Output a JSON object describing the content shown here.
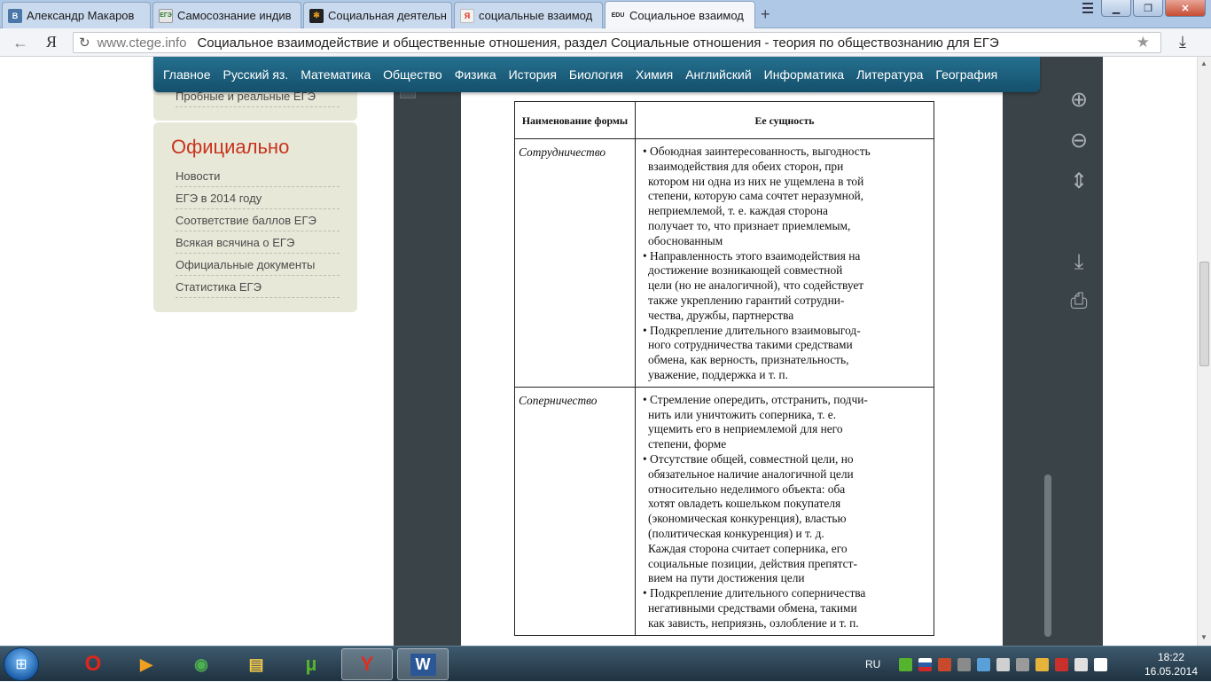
{
  "browser": {
    "tabs": [
      {
        "icon": "vk-favicon",
        "icon_text": "В",
        "title": "Александр Макаров"
      },
      {
        "icon": "ege-favicon",
        "icon_text": "ЕГЭ",
        "title": "Самосознание индив"
      },
      {
        "icon": "joomla-favicon",
        "icon_text": "✻",
        "title": "Социальная деятельн"
      },
      {
        "icon": "yandex-favicon",
        "icon_text": "Я",
        "title": "социальные взаимод"
      },
      {
        "icon": "edu-favicon",
        "icon_text": "EDU",
        "title": "Социальное взаимод"
      }
    ],
    "new_tab": "+",
    "yandex_logo": "Я",
    "address": {
      "domain": "www.ctege.info",
      "title": "Социальное взаимодействие и общественные отношения, раздел Социальные отношения - теория по обществознанию для ЕГЭ"
    },
    "window_buttons": {
      "minimize": "▁",
      "maximize": "❐",
      "close": "✕"
    }
  },
  "site": {
    "nav": [
      "Главное",
      "Русский яз.",
      "Математика",
      "Общество",
      "Физика",
      "История",
      "Биология",
      "Химия",
      "Английский",
      "Информатика",
      "Литература",
      "География"
    ],
    "sidebar_prev_link": "Пробные и реальные ЕГЭ",
    "official": {
      "title": "Официально",
      "links": [
        "Новости",
        "ЕГЭ в 2014 году",
        "Соответствие баллов ЕГЭ",
        "Всякая всячина о ЕГЭ",
        "Официальные документы",
        "Статистика ЕГЭ"
      ]
    }
  },
  "document": {
    "headers": {
      "form": "Наименование формы",
      "essence": "Ее сущность"
    },
    "rows": [
      {
        "form": "Сотрудничество",
        "bullets": [
          {
            "lines": [
              "Обоюдная заинтересованность, выгодность",
              "взаимодействия для обеих сторон, при",
              "котором ни одна из них не ущемлена в той",
              "степени, которую сама сочтет неразумной,",
              "неприемлемой, т. е. каждая сторона",
              "получает то, что признает приемлемым,",
              "обоснованным"
            ]
          },
          {
            "lines": [
              "Направленность  этого  взаимодействия на",
              "достижение возникающей совместной",
              "цели (но не аналогичной), что содействует",
              "также укреплению гарантий сотрудни-",
              "чества, дружбы, партнерства"
            ]
          },
          {
            "lines": [
              "Подкрепление длительного взаимовыгод-",
              "ного сотрудничества такими средствами",
              "обмена, как верность, признательность,",
              "уважение, поддержка и т. п."
            ]
          }
        ]
      },
      {
        "form": "Соперничество",
        "bullets": [
          {
            "lines": [
              "Стремление опередить, отстранить, подчи-",
              "нить или уничтожить соперника, т. е.",
              "ущемить его в неприемлемой для него",
              "степени, форме"
            ]
          },
          {
            "lines": [
              "Отсутствие общей, совместной цели, но",
              "обязательное наличие аналогичной цели",
              "относительно неделимого объекта: оба",
              "хотят овладеть кошельком покупателя",
              "(экономическая конкуренция), властью",
              "(политическая конкуренция) и т. д.",
              "Каждая сторона считает соперника, его",
              "социальные позиции, действия препятст-",
              "вием на пути достижения цели"
            ]
          },
          {
            "lines": [
              "Подкрепление длительного соперничества",
              "негативными средствами обмена, такими",
              "как зависть, неприязнь, озлобление и т. п."
            ]
          }
        ]
      }
    ]
  },
  "viewer_tools": {
    "zoom_in": "⊕",
    "zoom_out": "⊖",
    "fit": "⇕",
    "download": "⤓",
    "print": "⎙"
  },
  "taskbar": {
    "start": "⊞",
    "apps": [
      {
        "name": "opera",
        "glyph": "O",
        "color": "#e0261b"
      },
      {
        "name": "media-player",
        "glyph": "▶",
        "color": "#f0a020"
      },
      {
        "name": "media-center",
        "glyph": "◉",
        "color": "#4caf50"
      },
      {
        "name": "explorer",
        "glyph": "▤",
        "color": "#f2c94c"
      },
      {
        "name": "utorrent",
        "glyph": "µ",
        "color": "#56b32d"
      },
      {
        "name": "yandex-browser",
        "glyph": "Y",
        "color": "#e02d20"
      },
      {
        "name": "word",
        "glyph": "W",
        "color": "#2b5797"
      }
    ],
    "lang": "RU",
    "time": "18:22",
    "date": "16.05.2014"
  }
}
